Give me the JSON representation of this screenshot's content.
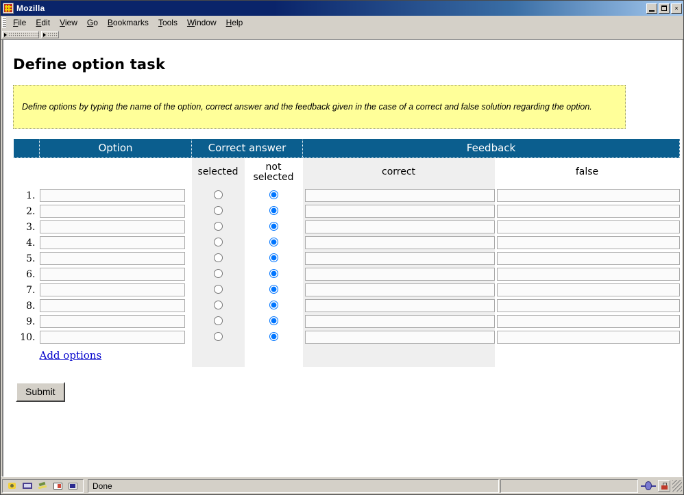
{
  "window": {
    "title": "Mozilla",
    "icon": "mozilla-icon",
    "minimize_label": "_",
    "maximize_label": "□",
    "close_label": "×"
  },
  "menubar": {
    "items": [
      {
        "label": "File",
        "accesskey": "F"
      },
      {
        "label": "Edit",
        "accesskey": "E"
      },
      {
        "label": "View",
        "accesskey": "V"
      },
      {
        "label": "Go",
        "accesskey": "G"
      },
      {
        "label": "Bookmarks",
        "accesskey": "B"
      },
      {
        "label": "Tools",
        "accesskey": "T"
      },
      {
        "label": "Window",
        "accesskey": "W"
      },
      {
        "label": "Help",
        "accesskey": "H"
      }
    ]
  },
  "page": {
    "title": "Define option task",
    "notice": "Define options by typing the name of the option, correct answer and the feedback given in the case of a correct and false solution regarding the option.",
    "add_options_label": "Add options",
    "submit_label": "Submit"
  },
  "table": {
    "header_blue": {
      "spacer": "",
      "option": "Option",
      "correct_answer": "Correct answer",
      "feedback": "Feedback"
    },
    "subheader": {
      "blank_num": "",
      "blank_option": "",
      "selected": "selected",
      "not_selected": "not selected",
      "correct": "correct",
      "false": "false"
    },
    "rows": [
      {
        "num": "1.",
        "option": "",
        "selected_checked": false,
        "not_selected_checked": true,
        "feedback_correct": "",
        "feedback_false": ""
      },
      {
        "num": "2.",
        "option": "",
        "selected_checked": false,
        "not_selected_checked": true,
        "feedback_correct": "",
        "feedback_false": ""
      },
      {
        "num": "3.",
        "option": "",
        "selected_checked": false,
        "not_selected_checked": true,
        "feedback_correct": "",
        "feedback_false": ""
      },
      {
        "num": "4.",
        "option": "",
        "selected_checked": false,
        "not_selected_checked": true,
        "feedback_correct": "",
        "feedback_false": ""
      },
      {
        "num": "5.",
        "option": "",
        "selected_checked": false,
        "not_selected_checked": true,
        "feedback_correct": "",
        "feedback_false": ""
      },
      {
        "num": "6.",
        "option": "",
        "selected_checked": false,
        "not_selected_checked": true,
        "feedback_correct": "",
        "feedback_false": ""
      },
      {
        "num": "7.",
        "option": "",
        "selected_checked": false,
        "not_selected_checked": true,
        "feedback_correct": "",
        "feedback_false": ""
      },
      {
        "num": "8.",
        "option": "",
        "selected_checked": false,
        "not_selected_checked": true,
        "feedback_correct": "",
        "feedback_false": ""
      },
      {
        "num": "9.",
        "option": "",
        "selected_checked": false,
        "not_selected_checked": true,
        "feedback_correct": "",
        "feedback_false": ""
      },
      {
        "num": "10.",
        "option": "",
        "selected_checked": false,
        "not_selected_checked": true,
        "feedback_correct": "",
        "feedback_false": ""
      }
    ]
  },
  "statusbar": {
    "icons": [
      "browser-icon",
      "composer-icon",
      "mail-icon",
      "addressbook-icon",
      "irc-icon"
    ],
    "status_text": "Done",
    "network_icon": "network-icon",
    "security_icon": "security-lock-icon",
    "resize_grip": "resize-grip"
  },
  "colors": {
    "header_blue": "#0b5e8e",
    "notice_yellow": "#ffff99",
    "link_blue": "#0000cc",
    "column_gray": "#efefef",
    "chrome_gray": "#d4d0c8"
  }
}
